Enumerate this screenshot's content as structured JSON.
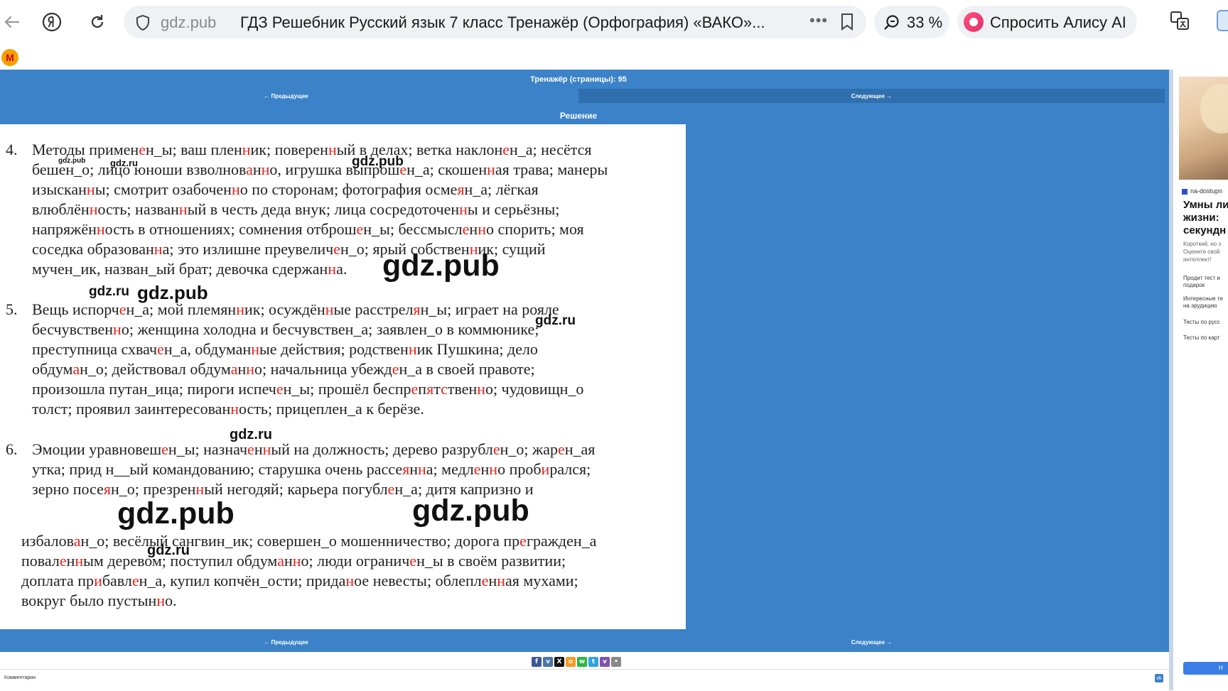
{
  "browser": {
    "domain": "gdz.pub",
    "tab_title": "ГДЗ Решебник Русский язык 7 класс Тренажёр (Орфография) «ВАКО»...",
    "zoom": "33 %",
    "alice_label": "Спросить Алису AI"
  },
  "page": {
    "header": "Тренажёр (страницы): 95",
    "prev": "← Предыдущее",
    "next": "Следующее →",
    "solution_title": "Решение",
    "comments_label": "Комментарии",
    "vk": "vk"
  },
  "exercises": [
    {
      "num": "4.",
      "lines": [
        [
          [
            "Методы примен",
            ""
          ],
          [
            "е",
            "r"
          ],
          [
            "н_ы; ваш плен",
            ""
          ],
          [
            "н",
            "r"
          ],
          [
            "ик; поверен",
            ""
          ],
          [
            "н",
            "r"
          ],
          [
            "ый в делах; ветка наклон",
            ""
          ],
          [
            "е",
            "r"
          ],
          [
            "н_а; несётся",
            ""
          ]
        ],
        [
          [
            "бешен_о; лицо юноши взволнов",
            ""
          ],
          [
            "а",
            "r"
          ],
          [
            "н",
            ""
          ],
          [
            "н",
            "r"
          ],
          [
            "о, игрушка выпрош",
            ""
          ],
          [
            "е",
            "r"
          ],
          [
            "н_а; скошен",
            ""
          ],
          [
            "н",
            "r"
          ],
          [
            "ая трава; манеры",
            ""
          ]
        ],
        [
          [
            "изыскан",
            ""
          ],
          [
            "н",
            "r"
          ],
          [
            "ы; смотрит озабочен",
            ""
          ],
          [
            "н",
            "r"
          ],
          [
            "о по сторонам; фотография осме",
            ""
          ],
          [
            "я",
            "r"
          ],
          [
            "н_а; лёгкая",
            ""
          ]
        ],
        [
          [
            "влюблён",
            ""
          ],
          [
            "н",
            "r"
          ],
          [
            "ость; назван",
            ""
          ],
          [
            "н",
            "r"
          ],
          [
            "ый в честь деда внук; лица сосредоточен",
            ""
          ],
          [
            "н",
            "r"
          ],
          [
            "ы и серьёзны;",
            ""
          ]
        ],
        [
          [
            "напряжён",
            ""
          ],
          [
            "н",
            "r"
          ],
          [
            "ость в отношениях; сомнения отброш",
            ""
          ],
          [
            "е",
            "r"
          ],
          [
            "н_ы; бессмысл",
            ""
          ],
          [
            "е",
            "r"
          ],
          [
            "н",
            ""
          ],
          [
            "н",
            "r"
          ],
          [
            "о спорить; моя",
            ""
          ]
        ],
        [
          [
            "соседка образован",
            ""
          ],
          [
            "н",
            "r"
          ],
          [
            "а; это излишне преувелич",
            ""
          ],
          [
            "е",
            "r"
          ],
          [
            "н_о; ярый собствен",
            ""
          ],
          [
            "н",
            "r"
          ],
          [
            "ик; сущий",
            ""
          ]
        ],
        [
          [
            "мучен_ик, назван_ый брат; девочка сдержан",
            ""
          ],
          [
            "н",
            "r"
          ],
          [
            "а.",
            ""
          ]
        ]
      ]
    },
    {
      "num": "5.",
      "lines": [
        [
          [
            "Вещь испорч",
            ""
          ],
          [
            "е",
            "r"
          ],
          [
            "н_а; мой племян",
            ""
          ],
          [
            "н",
            "r"
          ],
          [
            "ик; осуждён",
            ""
          ],
          [
            "н",
            "r"
          ],
          [
            "ые расстрел",
            ""
          ],
          [
            "я",
            "r"
          ],
          [
            "н_ы; играет на рояле",
            ""
          ]
        ],
        [
          [
            "бесчувствен",
            ""
          ],
          [
            "н",
            "r"
          ],
          [
            "о; женщина холодна и бесчувствен_а; заявлен_о в коммюнике;",
            ""
          ]
        ],
        [
          [
            "преступница схвач",
            ""
          ],
          [
            "е",
            "r"
          ],
          [
            "н_а, обдуман",
            ""
          ],
          [
            "н",
            "r"
          ],
          [
            "ые действия; родствен",
            ""
          ],
          [
            "н",
            "r"
          ],
          [
            "ик Пушкина; дело",
            ""
          ]
        ],
        [
          [
            "обдум",
            ""
          ],
          [
            "а",
            "r"
          ],
          [
            "н_о; действовал обдум",
            ""
          ],
          [
            "а",
            "r"
          ],
          [
            "н",
            ""
          ],
          [
            "н",
            "r"
          ],
          [
            "о; начальница убежд",
            ""
          ],
          [
            "е",
            "r"
          ],
          [
            "н_а в своей правоте;",
            ""
          ]
        ],
        [
          [
            "произошла путан_ица; пироги испеч",
            ""
          ],
          [
            "е",
            "r"
          ],
          [
            "н_ы; прошёл беспр",
            ""
          ],
          [
            "е",
            "r"
          ],
          [
            "п",
            ""
          ],
          [
            "я",
            "r"
          ],
          [
            "т",
            ""
          ],
          [
            "с",
            "r"
          ],
          [
            "твен",
            ""
          ],
          [
            "н",
            "r"
          ],
          [
            "о; чудовищн_о",
            ""
          ]
        ],
        [
          [
            "толст; проявил заинтересован",
            ""
          ],
          [
            "н",
            "r"
          ],
          [
            "ость; прицеплен_а к берёзе.",
            ""
          ]
        ]
      ]
    },
    {
      "num": "6.",
      "lines": [
        [
          [
            "Эмоции уравновеш",
            ""
          ],
          [
            "е",
            "r"
          ],
          [
            "н_ы; назнач",
            ""
          ],
          [
            "е",
            "r"
          ],
          [
            "н",
            ""
          ],
          [
            "н",
            "r"
          ],
          [
            "ый на должность; дерево разрубл",
            ""
          ],
          [
            "е",
            "r"
          ],
          [
            "н_о; жар",
            ""
          ],
          [
            "е",
            "r"
          ],
          [
            "н_ая",
            ""
          ]
        ],
        [
          [
            "утка; прид н__ый командованию; старушка очень рассе",
            ""
          ],
          [
            "я",
            "r"
          ],
          [
            "н",
            ""
          ],
          [
            "н",
            "r"
          ],
          [
            "а; медл",
            ""
          ],
          [
            "е",
            "r"
          ],
          [
            "н",
            ""
          ],
          [
            "н",
            "r"
          ],
          [
            "о проб",
            ""
          ],
          [
            "и",
            "r"
          ],
          [
            "рался;",
            ""
          ]
        ],
        [
          [
            "зерно посе",
            ""
          ],
          [
            "я",
            "r"
          ],
          [
            "н_о; презрен",
            ""
          ],
          [
            "н",
            "r"
          ],
          [
            "ый негодяй; карьера погубл",
            ""
          ],
          [
            "е",
            "r"
          ],
          [
            "н_а; дитя капризно и",
            ""
          ]
        ]
      ]
    },
    {
      "num": "",
      "lines": [
        [
          [
            "избалов",
            ""
          ],
          [
            "а",
            "r"
          ],
          [
            "н_о; весёлый сангвин_ик; совершен_о мошенничество; дорога пр",
            ""
          ],
          [
            "е",
            "r"
          ],
          [
            "гражден_а",
            ""
          ]
        ],
        [
          [
            "повал",
            ""
          ],
          [
            "е",
            "r"
          ],
          [
            "н",
            ""
          ],
          [
            "н",
            "r"
          ],
          [
            "ым деревом; поступил обдум",
            ""
          ],
          [
            "а",
            "r"
          ],
          [
            "н",
            ""
          ],
          [
            "н",
            "r"
          ],
          [
            "о; люди огранич",
            ""
          ],
          [
            "е",
            "r"
          ],
          [
            "н_ы в своём развитии;",
            ""
          ]
        ],
        [
          [
            "доплата пр",
            ""
          ],
          [
            "и",
            "r"
          ],
          [
            "бавл",
            ""
          ],
          [
            "е",
            "r"
          ],
          [
            "н_а, купил копчён_ости; прида",
            ""
          ],
          [
            "н",
            "r"
          ],
          [
            "ое невесты; облепл",
            ""
          ],
          [
            "е",
            "r"
          ],
          [
            "н",
            ""
          ],
          [
            "н",
            "r"
          ],
          [
            "ая мухами;",
            ""
          ]
        ],
        [
          [
            "вокруг было пустын",
            ""
          ],
          [
            "н",
            "r"
          ],
          [
            "о.",
            ""
          ]
        ]
      ]
    }
  ],
  "watermarks": {
    "w1": "gdz.pub",
    "w2": "gdz.ru",
    "w3": "gdz.pub",
    "w4": "gdz.ru",
    "w5": "gdz.pub",
    "w6": "gdz.ru",
    "w7": "gdz.ru",
    "w8": "gdz.pub",
    "w9": "gdz.pub",
    "w10": "gdz.ru"
  },
  "ad": {
    "source": "na-dostupn",
    "headline_1": "Умны ли",
    "headline_2": "жизни:",
    "headline_3": "секундн",
    "desc_1": "Короткий, но з",
    "desc_2": "Оцените свой",
    "desc_3": "интеллект!",
    "item_1a": "Продит тест и",
    "item_1b": "подарок",
    "item_2a": "Интересные те",
    "item_2b": "на эрудицию",
    "item_3": "Тесты по русс",
    "item_4": "Тесты по карт",
    "button": "Н"
  },
  "share": [
    {
      "name": "facebook-icon",
      "glyph": "f",
      "color": "#3b5998"
    },
    {
      "name": "vk-icon",
      "glyph": "v",
      "color": "#4a76a8"
    },
    {
      "name": "x-icon",
      "glyph": "X",
      "color": "#111111"
    },
    {
      "name": "odnoklassniki-icon",
      "glyph": "o",
      "color": "#f59a23"
    },
    {
      "name": "whatsapp-icon",
      "glyph": "w",
      "color": "#2cb742"
    },
    {
      "name": "telegram-icon",
      "glyph": "t",
      "color": "#30a2e1"
    },
    {
      "name": "viber-icon",
      "glyph": "v",
      "color": "#7d52ae"
    },
    {
      "name": "more-icon",
      "glyph": "•",
      "color": "#888888"
    }
  ]
}
